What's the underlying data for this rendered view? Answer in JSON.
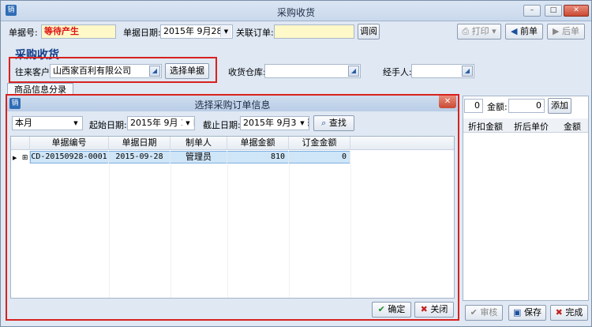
{
  "window": {
    "title": "采购收货",
    "app_icon": "销"
  },
  "controls": {
    "minimize": "–",
    "maximize": "□",
    "close": "✕"
  },
  "header": {
    "doc_no_label": "单据号:",
    "doc_no_value": "等待产生",
    "doc_date_label": "单据日期:",
    "doc_date_value": "2015年 9月28日",
    "related_order_label": "关联订单:",
    "related_order_value": "",
    "lookup_btn": "调阅",
    "print_btn": "打印",
    "prev_btn": "前单",
    "next_btn": "后单"
  },
  "section_title": "采购收货",
  "form": {
    "customer_label": "往来客户:",
    "customer_value": "山西家百利有限公司",
    "select_doc_btn": "选择单据",
    "warehouse_label": "收货仓库:",
    "warehouse_value": "",
    "handler_label": "经手人:",
    "handler_value": ""
  },
  "tab_label": "商品信息分录",
  "right_panel": {
    "qty_value": "0",
    "amount_label": "金额:",
    "amount_value": "0",
    "add_btn": "添加",
    "col_discount_amount": "折扣金额",
    "col_discounted_price": "折后单价",
    "col_amount": "金额"
  },
  "bottom": {
    "audit_btn": "审核",
    "save_btn": "保存",
    "finish_btn": "完成"
  },
  "dialog": {
    "title": "选择采购订单信息",
    "period_value": "本月",
    "start_label": "起始日期:",
    "start_value": "2015年 9月 1日",
    "end_label": "截止日期:",
    "end_value": "2015年 9月30日",
    "search_btn": "查找",
    "columns": [
      "单据编号",
      "单据日期",
      "制单人",
      "单据金额",
      "订金金额"
    ],
    "rows": [
      {
        "doc_no": "CD-20150928-0001",
        "date": "2015-09-28",
        "maker": "管理员",
        "amount": "810",
        "deposit": "0"
      }
    ],
    "ok_btn": "确定",
    "close_btn": "关闭"
  }
}
